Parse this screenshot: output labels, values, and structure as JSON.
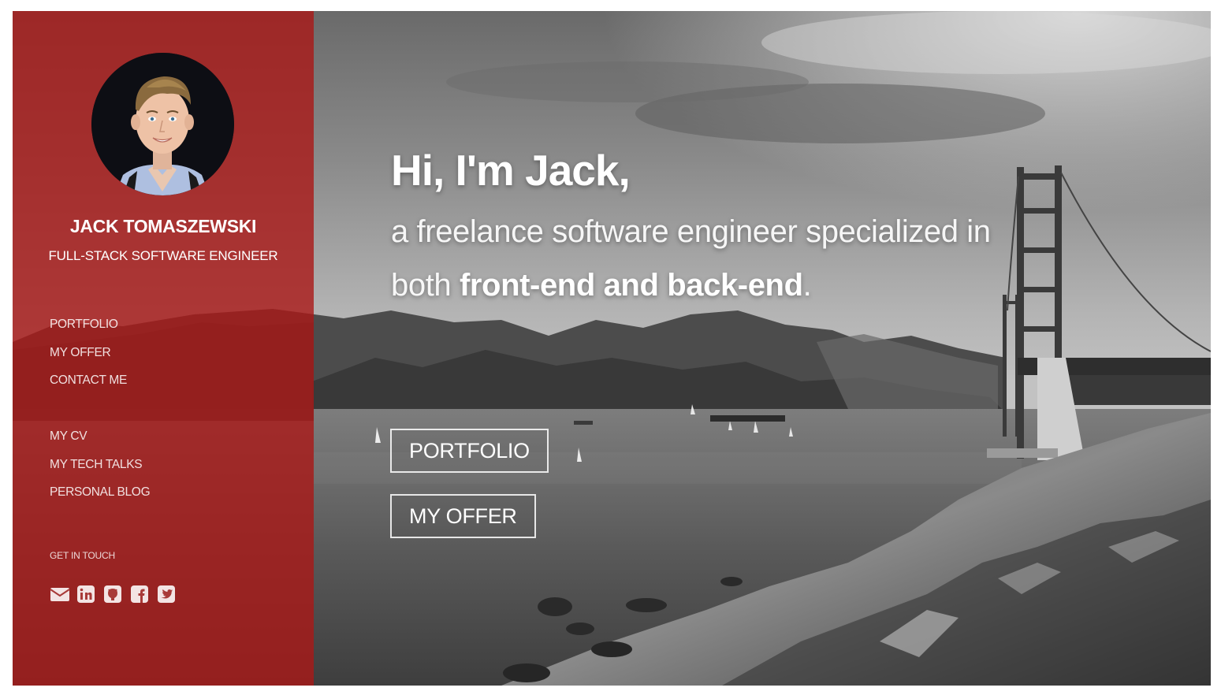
{
  "profile": {
    "name": "JACK TOMASZEWSKI",
    "role": "FULL-STACK SOFTWARE ENGINEER"
  },
  "nav": {
    "primary": [
      {
        "label": "PORTFOLIO"
      },
      {
        "label": "MY OFFER"
      },
      {
        "label": "CONTACT ME"
      }
    ],
    "secondary": [
      {
        "label": "MY CV"
      },
      {
        "label": "MY TECH TALKS"
      },
      {
        "label": "PERSONAL BLOG"
      }
    ]
  },
  "contact": {
    "heading": "GET IN TOUCH",
    "icons": [
      "email-icon",
      "linkedin-icon",
      "github-icon",
      "facebook-icon",
      "twitter-icon"
    ]
  },
  "hero": {
    "greeting": "Hi, I'm Jack,",
    "line1": "a freelance software engineer specialized in",
    "line2_prefix": "both ",
    "line2_bold": "front-end and back-end",
    "line2_suffix": ".",
    "buttons": {
      "portfolio": "PORTFOLIO",
      "offer": "MY OFFER"
    }
  },
  "colors": {
    "sidebar": "#AA1816",
    "text": "#FFFFFF"
  }
}
